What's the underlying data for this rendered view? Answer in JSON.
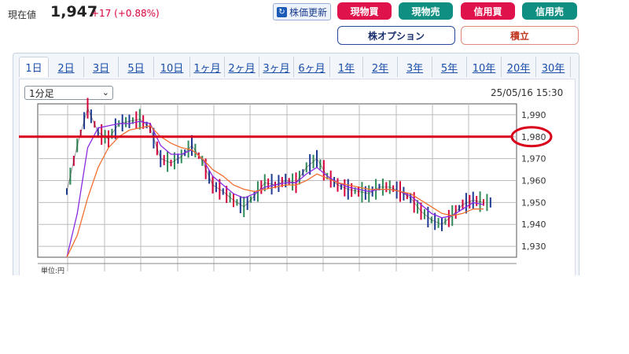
{
  "header": {
    "price_label": "現在値",
    "price_value": "1,947",
    "price_change": "+17 (+0.88%)"
  },
  "actions": {
    "refresh_label": "株価更新",
    "buttons": [
      {
        "label": "現物買",
        "color": "#e0124b"
      },
      {
        "label": "現物売",
        "color": "#0f8f82"
      },
      {
        "label": "信用買",
        "color": "#e0124b"
      },
      {
        "label": "信用売",
        "color": "#0f8f82"
      }
    ],
    "option_label": "株オプション",
    "tsumitate_label": "積立"
  },
  "tabs": [
    "1日",
    "2日",
    "3日",
    "5日",
    "10日",
    "1ヶ月",
    "2ヶ月",
    "3ヶ月",
    "6ヶ月",
    "1年",
    "2年",
    "3年",
    "5年",
    "10年",
    "20年",
    "30年"
  ],
  "active_tab": "1日",
  "interval_select": {
    "value": "1分足"
  },
  "timestamp": "25/05/16 15:30",
  "footer_label": "単位:円",
  "annotation": {
    "line_price": 1980,
    "color": "#d8001a"
  },
  "chart_data": {
    "type": "line",
    "ylim": [
      1925,
      1995
    ],
    "yticks": [
      "1,930",
      "1,940",
      "1,950",
      "1,960",
      "1,970",
      "1,980",
      "1,990"
    ],
    "ytick_values": [
      1930,
      1940,
      1950,
      1960,
      1970,
      1980,
      1990
    ],
    "series": [
      {
        "color": "#d8003a",
        "values": [
          1955,
          1976,
          1993,
          1982,
          1979,
          1986,
          1987,
          1988,
          1984,
          1970,
          1968,
          1971,
          1976,
          1969,
          1958,
          1955,
          1951,
          1948,
          1953,
          1959,
          1958,
          1960,
          1959,
          1966,
          1970,
          1962,
          1958,
          1956,
          1955,
          1954,
          1957,
          1957,
          1955,
          1952,
          1946,
          1942,
          1940,
          1944,
          1949,
          1951,
          1950
        ]
      },
      {
        "color": "#8a2be2",
        "values": [
          1925,
          1945,
          1975,
          1984,
          1985,
          1986,
          1986,
          1987,
          1986,
          1976,
          1972,
          1972,
          1974,
          1970,
          1962,
          1958,
          1954,
          1952,
          1954,
          1957,
          1958,
          1959,
          1959,
          1963,
          1966,
          1962,
          1959,
          1957,
          1956,
          1955,
          1956,
          1956,
          1955,
          1953,
          1949,
          1945,
          1943,
          1944,
          1947,
          1950,
          1949
        ]
      },
      {
        "color": "#f07030",
        "values": [
          1925,
          1935,
          1952,
          1966,
          1975,
          1980,
          1983,
          1984,
          1985,
          1980,
          1977,
          1975,
          1974,
          1970,
          1965,
          1962,
          1958,
          1956,
          1955,
          1956,
          1957,
          1958,
          1958,
          1960,
          1963,
          1961,
          1959,
          1958,
          1957,
          1956,
          1956,
          1956,
          1955,
          1954,
          1951,
          1948,
          1945,
          1944,
          1945,
          1947,
          1947
        ]
      }
    ]
  }
}
